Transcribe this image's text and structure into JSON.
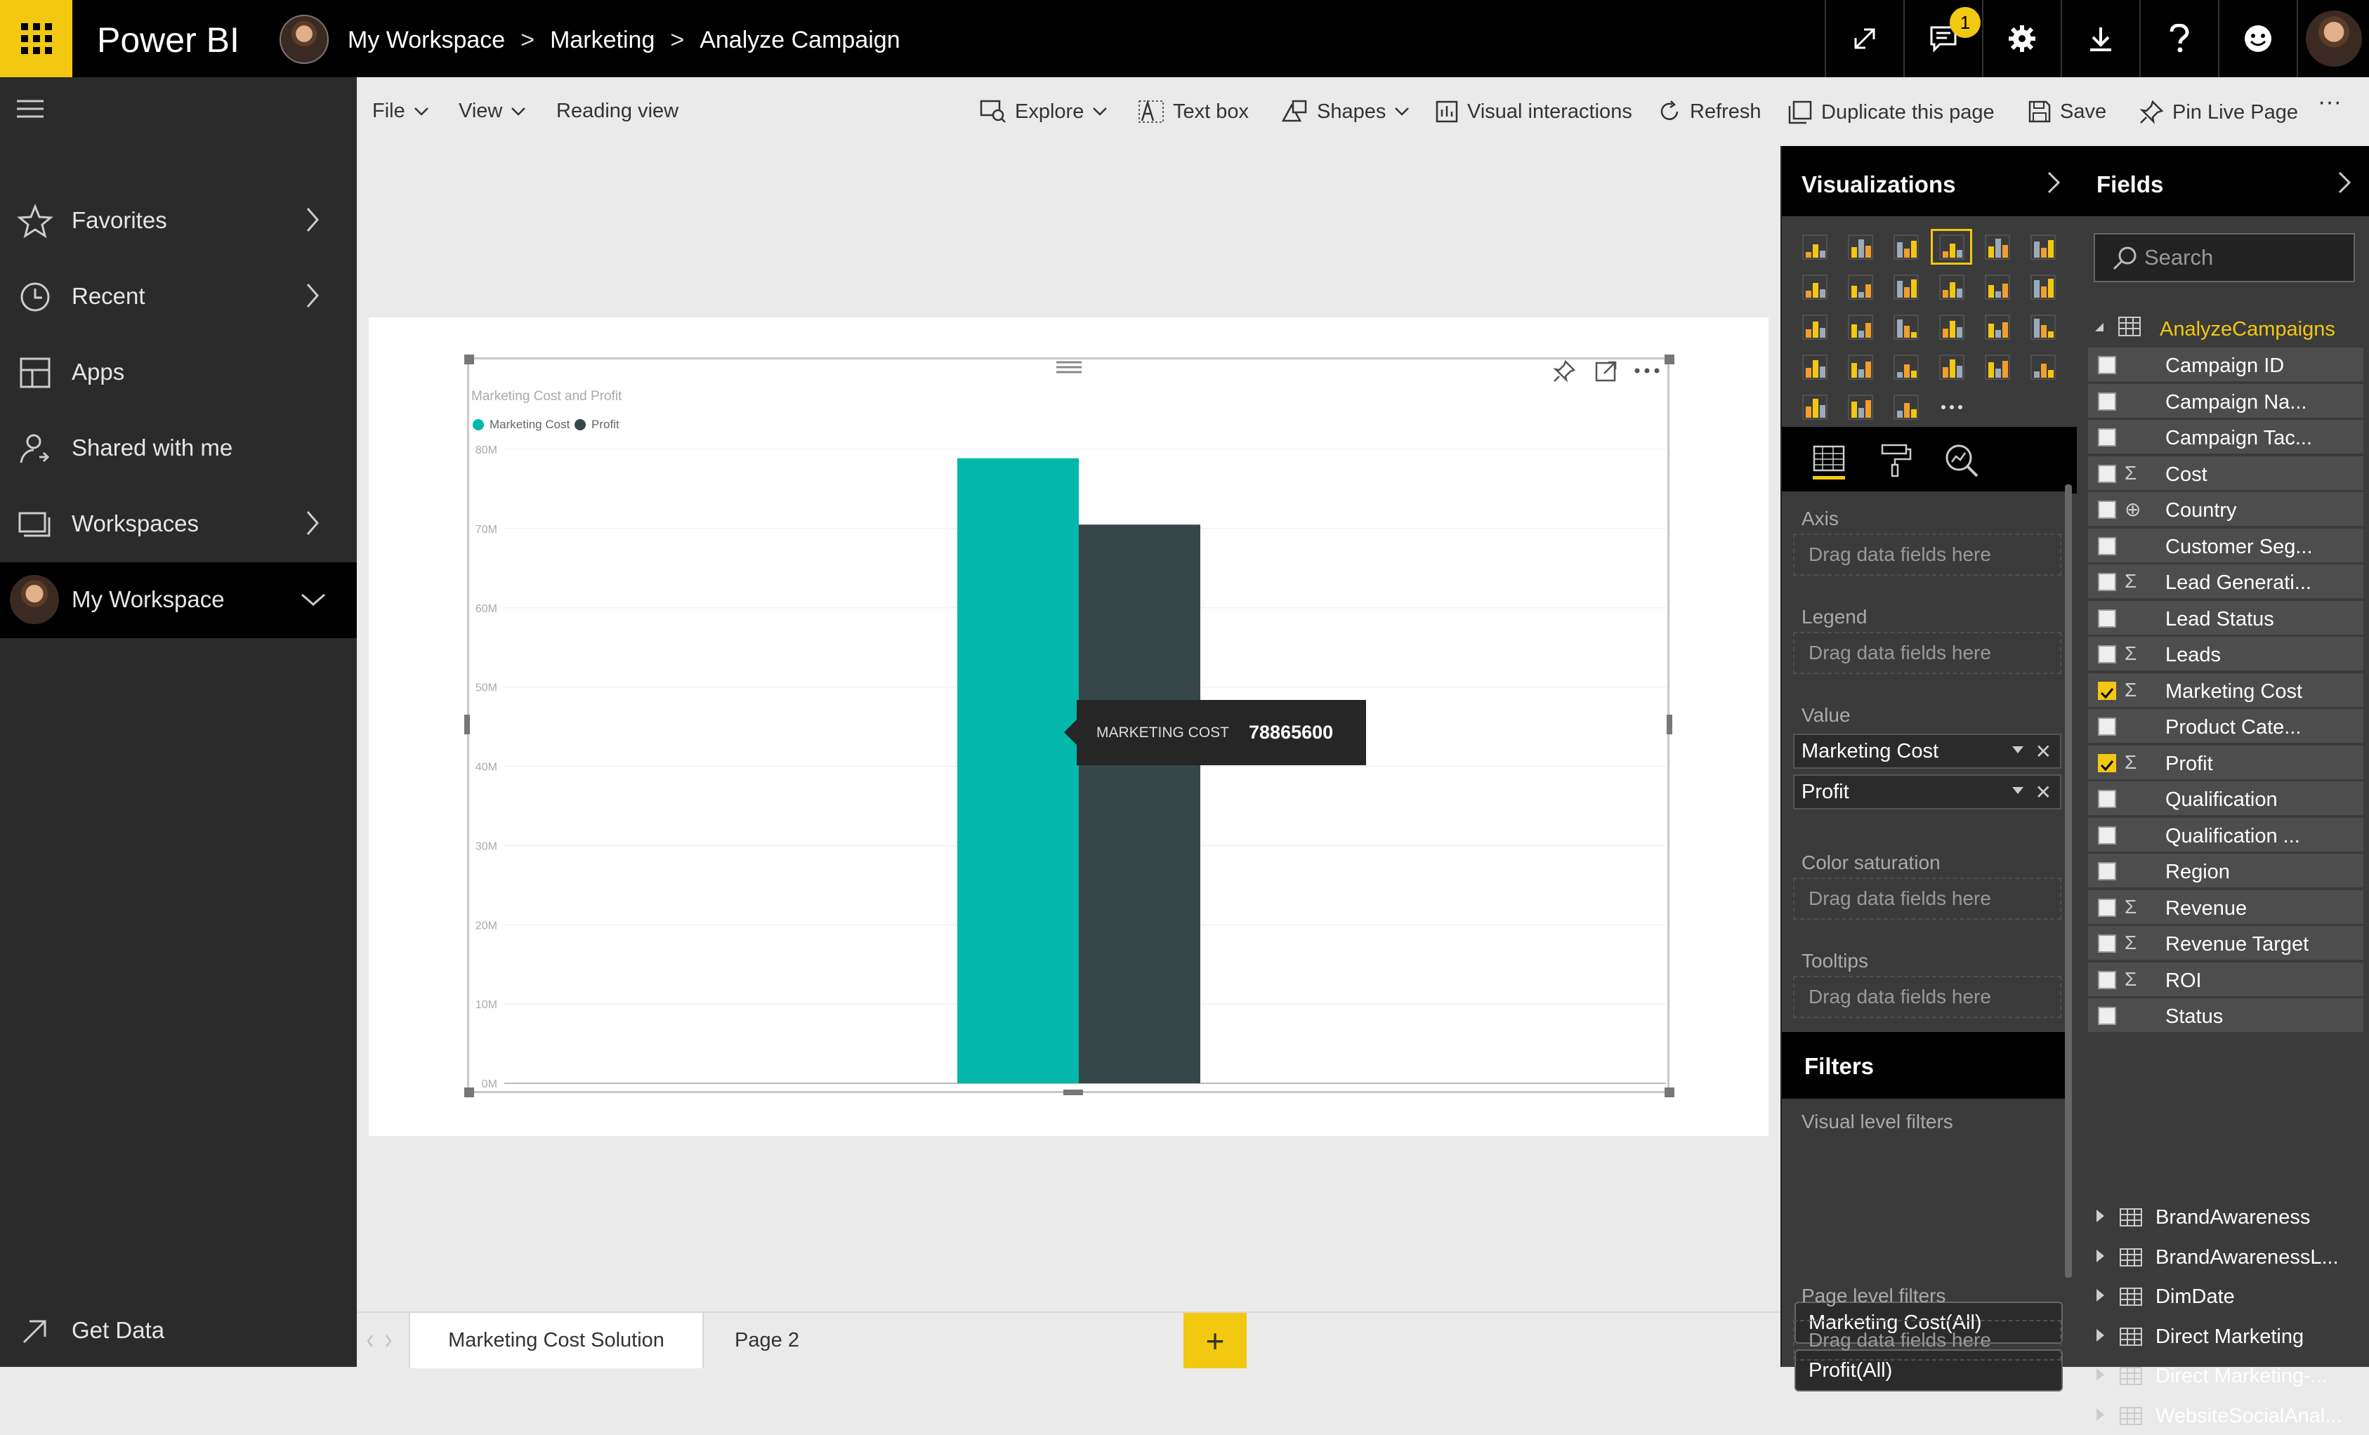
{
  "app": {
    "title": "Power BI"
  },
  "breadcrumb": [
    "My Workspace",
    "Marketing",
    "Analyze Campaign"
  ],
  "notifications": {
    "count": "1"
  },
  "nav": {
    "items": [
      {
        "label": "Favorites"
      },
      {
        "label": "Recent"
      },
      {
        "label": "Apps"
      },
      {
        "label": "Shared with me"
      },
      {
        "label": "Workspaces"
      },
      {
        "label": "My Workspace"
      }
    ],
    "bottom": {
      "label": "Get Data"
    }
  },
  "commands": {
    "file": "File",
    "view": "View",
    "reading": "Reading view",
    "explore": "Explore",
    "textbox": "Text box",
    "shapes": "Shapes",
    "interactions": "Visual interactions",
    "refresh": "Refresh",
    "duplicate": "Duplicate this page",
    "save": "Save",
    "pin": "Pin Live Page",
    "more": "···"
  },
  "chart_data": {
    "type": "bar",
    "title": "Marketing Cost and Profit",
    "categories": [
      ""
    ],
    "series": [
      {
        "name": "Marketing Cost",
        "values": [
          78865600
        ],
        "color": "#01b8aa"
      },
      {
        "name": "Profit",
        "values": [
          70500000
        ],
        "color": "#374649"
      }
    ],
    "ylim": [
      0,
      80000000
    ],
    "yticks": [
      "0M",
      "10M",
      "20M",
      "30M",
      "40M",
      "50M",
      "60M",
      "70M",
      "80M"
    ],
    "legend": "top-left",
    "grid": true,
    "tooltip": {
      "label": "MARKETING COST",
      "value": "78865600"
    }
  },
  "tabs": [
    {
      "label": "Marketing Cost Solution",
      "active": true
    },
    {
      "label": "Page 2",
      "active": false
    }
  ],
  "visualizations": {
    "title": "Visualizations",
    "wells": {
      "axis": "Axis",
      "legend": "Legend",
      "value": "Value",
      "color_saturation": "Color saturation",
      "tooltips": "Tooltips",
      "drop": "Drag data fields here",
      "value_fields": [
        "Marketing Cost",
        "Profit"
      ]
    },
    "filters": {
      "title": "Filters",
      "visual_level": "Visual level filters",
      "items": [
        "Marketing Cost(All)",
        "Profit(All)"
      ],
      "page_level": "Page level filters",
      "drop": "Drag data fields here"
    }
  },
  "fields": {
    "title": "Fields",
    "search_placeholder": "Search",
    "table": "AnalyzeCampaigns",
    "items": [
      {
        "name": "Campaign ID",
        "sigma": false,
        "checked": false
      },
      {
        "name": "Campaign Na...",
        "sigma": false,
        "checked": false
      },
      {
        "name": "Campaign Tac...",
        "sigma": false,
        "checked": false
      },
      {
        "name": "Cost",
        "sigma": true,
        "checked": false
      },
      {
        "name": "Country",
        "sigma": false,
        "globe": true,
        "checked": false
      },
      {
        "name": "Customer Seg...",
        "sigma": false,
        "checked": false
      },
      {
        "name": "Lead Generati...",
        "sigma": true,
        "checked": false
      },
      {
        "name": "Lead Status",
        "sigma": false,
        "checked": false
      },
      {
        "name": "Leads",
        "sigma": true,
        "checked": false
      },
      {
        "name": "Marketing Cost",
        "sigma": true,
        "checked": true
      },
      {
        "name": "Product Cate...",
        "sigma": false,
        "checked": false
      },
      {
        "name": "Profit",
        "sigma": true,
        "checked": true
      },
      {
        "name": "Qualification",
        "sigma": false,
        "checked": false
      },
      {
        "name": "Qualification ...",
        "sigma": false,
        "checked": false
      },
      {
        "name": "Region",
        "sigma": false,
        "checked": false
      },
      {
        "name": "Revenue",
        "sigma": true,
        "checked": false
      },
      {
        "name": "Revenue Target",
        "sigma": true,
        "checked": false
      },
      {
        "name": "ROI",
        "sigma": true,
        "checked": false
      },
      {
        "name": "Status",
        "sigma": false,
        "checked": false
      }
    ],
    "tables": [
      "BrandAwareness",
      "BrandAwarenessL...",
      "DimDate",
      "Direct Marketing",
      "Direct Marketing-...",
      "WebsiteSocialAnal..."
    ]
  },
  "colors": {
    "accent": "#f2c811",
    "teal": "#01b8aa",
    "dark": "#374649"
  }
}
